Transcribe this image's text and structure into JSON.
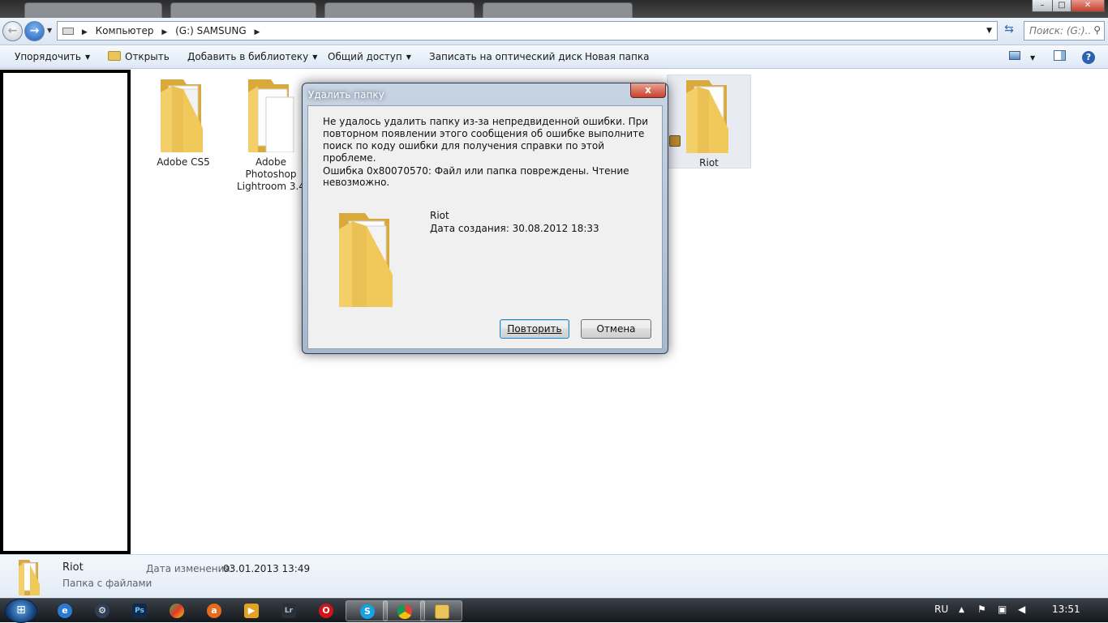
{
  "window": {
    "controls": {
      "minimize": "–",
      "maximize": "□",
      "close": "✕"
    }
  },
  "address": {
    "crumbs": [
      "Компьютер",
      "(G:) SAMSUNG"
    ],
    "search_placeholder": "Поиск: (G:)..."
  },
  "toolbar": {
    "organize": "Упорядочить",
    "open": "Открыть",
    "add_to_library": "Добавить в библиотеку",
    "share": "Общий доступ",
    "burn": "Записать на оптический диск",
    "new_folder": "Новая папка"
  },
  "folders": [
    {
      "label": "Adobe CS5"
    },
    {
      "label": "Adobe Photoshop Lightroom 3.4"
    },
    {
      "label": "Riot",
      "locked": true,
      "selected": true
    }
  ],
  "dialog": {
    "title": "Удалить папку",
    "close": "x",
    "message": "Не удалось удалить папку из-за непредвиденной ошибки. При повторном появлении этого сообщения об ошибке выполните поиск по коду ошибки для получения справки по этой проблеме.",
    "error": "Ошибка 0x80070570: Файл или папка повреждены. Чтение невозможно.",
    "item_name": "Riot",
    "item_date": "Дата создания: 30.08.2012 18:33",
    "retry": "Повторить",
    "cancel": "Отмена"
  },
  "details": {
    "name": "Riot",
    "type": "Папка с файлами",
    "modified_label": "Дата изменения:",
    "modified_value": "03.01.2013 13:49"
  },
  "taskbar": {
    "apps": [
      "internet-explorer",
      "steam",
      "photoshop",
      "google-earth",
      "avast",
      "media-player",
      "lightroom",
      "opera",
      "skype",
      "chrome",
      "explorer"
    ],
    "language": "RU",
    "clock": "13:51"
  },
  "colors": {
    "accent": "#2f6db6",
    "dialog_frame": "#a7b8cc",
    "close_red": "#c6412c",
    "folder_yellow": "#f0c95a"
  }
}
